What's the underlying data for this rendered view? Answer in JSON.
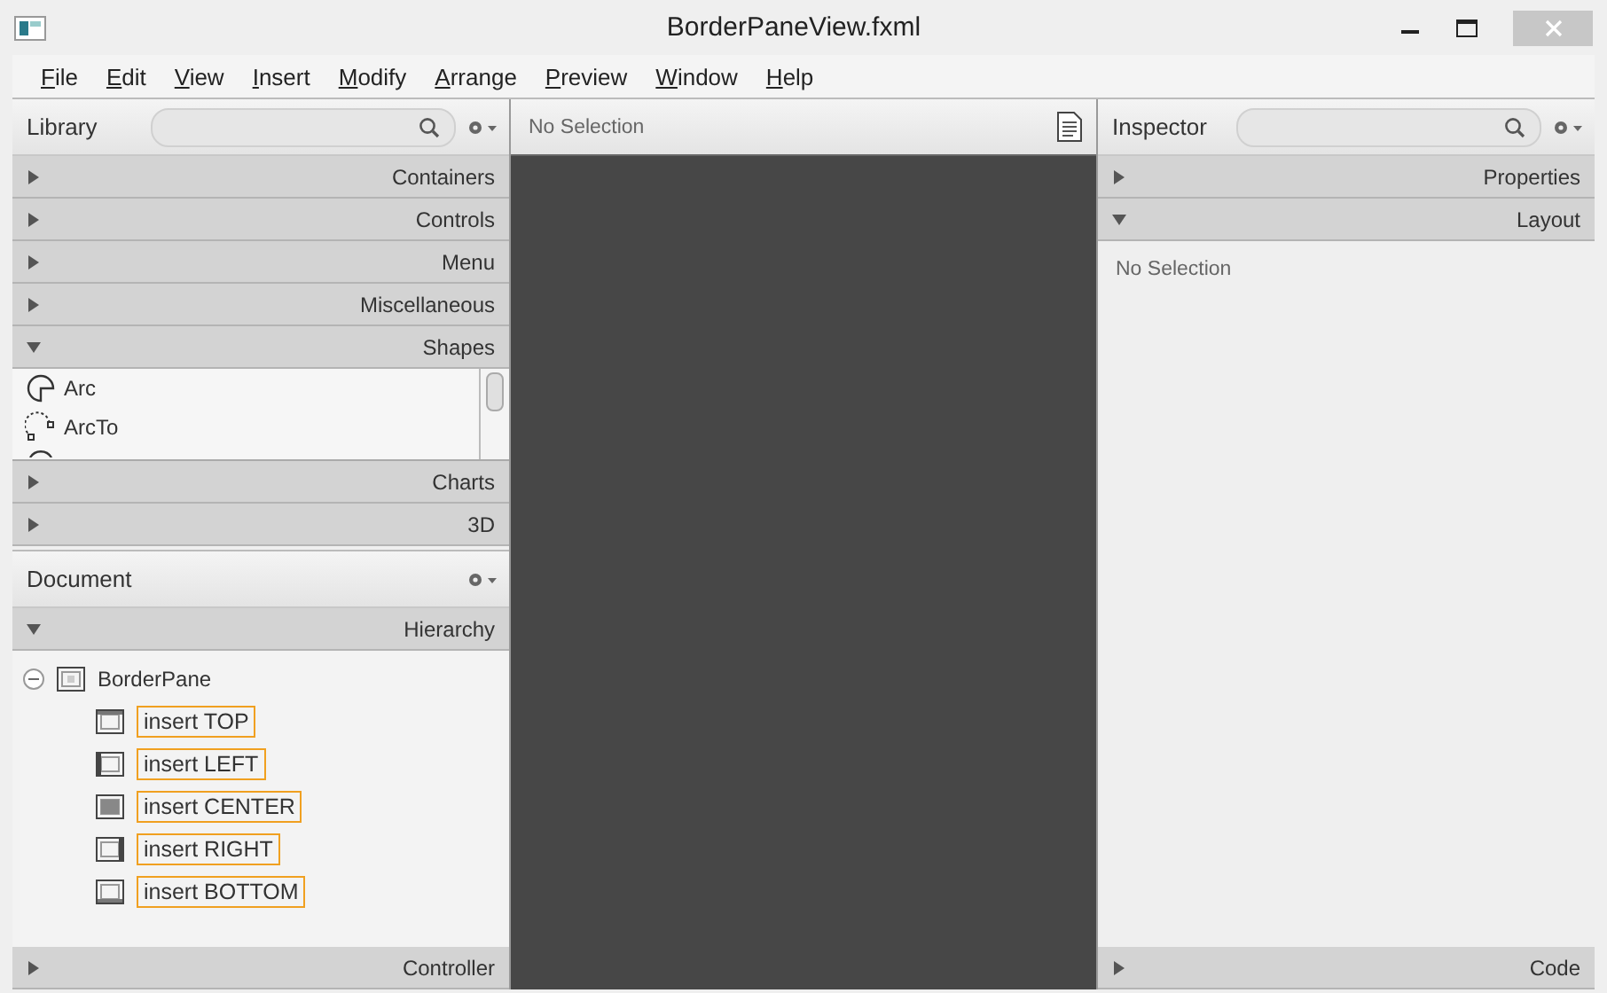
{
  "window": {
    "title": "BorderPaneView.fxml"
  },
  "menu": [
    {
      "label": "File"
    },
    {
      "label": "Edit"
    },
    {
      "label": "View"
    },
    {
      "label": "Insert"
    },
    {
      "label": "Modify"
    },
    {
      "label": "Arrange"
    },
    {
      "label": "Preview"
    },
    {
      "label": "Window"
    },
    {
      "label": "Help"
    }
  ],
  "library": {
    "title": "Library",
    "sections": [
      {
        "label": "Containers",
        "expanded": false
      },
      {
        "label": "Controls",
        "expanded": false
      },
      {
        "label": "Menu",
        "expanded": false
      },
      {
        "label": "Miscellaneous",
        "expanded": false
      },
      {
        "label": "Shapes",
        "expanded": true,
        "items": [
          {
            "label": "Arc",
            "kind": "arc"
          },
          {
            "label": "ArcTo",
            "kind": "arcto"
          }
        ]
      },
      {
        "label": "Charts",
        "expanded": false
      },
      {
        "label": "3D",
        "expanded": false
      }
    ]
  },
  "document": {
    "title": "Document",
    "sections": [
      {
        "label": "Hierarchy",
        "expanded": true
      }
    ],
    "tree": [
      {
        "label": "BorderPane",
        "kind": "pane",
        "expanded": true,
        "children": [
          {
            "label": "insert TOP",
            "kind": "top"
          },
          {
            "label": "insert LEFT",
            "kind": "left"
          },
          {
            "label": "insert CENTER",
            "kind": "center"
          },
          {
            "label": "insert RIGHT",
            "kind": "right"
          },
          {
            "label": "insert BOTTOM",
            "kind": "bottom"
          }
        ]
      }
    ],
    "footer": {
      "label": "Controller",
      "expanded": false
    }
  },
  "content": {
    "status": "No Selection"
  },
  "inspector": {
    "title": "Inspector",
    "sections": [
      {
        "label": "Properties",
        "expanded": false
      },
      {
        "label": "Layout",
        "expanded": true
      }
    ],
    "message": "No Selection",
    "footer": {
      "label": "Code",
      "expanded": false
    }
  }
}
